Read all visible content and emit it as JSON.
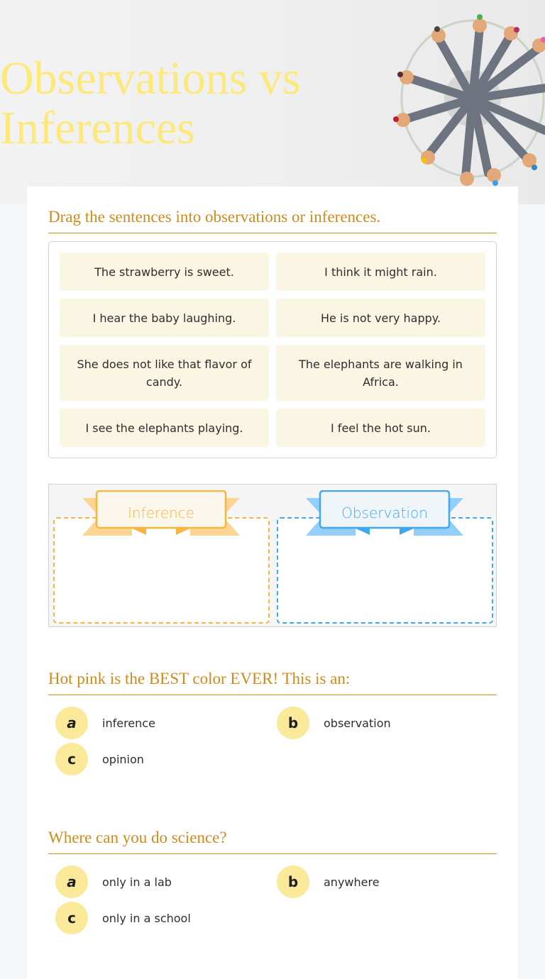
{
  "header": {
    "title_line1": "Observations vs",
    "title_line2": "Inferences",
    "title_color": "#fde97a"
  },
  "drag_question": {
    "prompt": "Drag the sentences into observations or inferences.",
    "sentences": [
      "The strawberry is sweet.",
      "I think it might rain.",
      "I hear the baby laughing.",
      "He is not very happy.",
      "She does not like that flavor of candy.",
      "The elephants are walking in Africa.",
      "I see the elephants playing.",
      "I feel the hot sun."
    ],
    "categories": [
      {
        "label": "Inference",
        "color": "#f8b640"
      },
      {
        "label": "Observation",
        "color": "#3fa8ee"
      }
    ]
  },
  "questions": [
    {
      "prompt": "Hot pink is the BEST color EVER! This is an:",
      "options": [
        {
          "letter": "a",
          "text": "inference"
        },
        {
          "letter": "b",
          "text": "observation"
        },
        {
          "letter": "c",
          "text": "opinion"
        }
      ]
    },
    {
      "prompt": "Where can you do science?",
      "options": [
        {
          "letter": "a",
          "text": "only in a lab"
        },
        {
          "letter": "b",
          "text": "anywhere"
        },
        {
          "letter": "c",
          "text": "only in a school"
        }
      ]
    }
  ],
  "theme": {
    "accent": "#cf8a1e",
    "chip_bg": "#fbf5e4",
    "bubble_bg": "#fbe99a"
  }
}
